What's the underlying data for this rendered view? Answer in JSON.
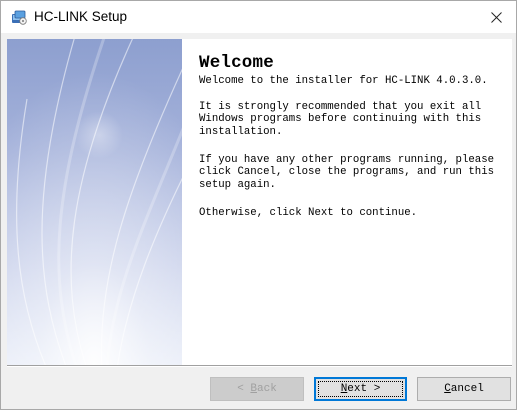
{
  "window": {
    "title": "HC-LINK Setup",
    "icon": "installer-icon",
    "close_symbol": "×"
  },
  "content": {
    "heading": "Welcome",
    "paragraph1": "Welcome to the installer for HC-LINK 4.0.3.0.",
    "paragraph2": "It is strongly recommended that you exit all\nWindows programs before continuing with this\ninstallation.",
    "paragraph3": "If you have any other programs running, please\nclick Cancel, close the programs, and run this\nsetup again.",
    "paragraph4": "Otherwise, click Next to continue."
  },
  "buttons": {
    "back": {
      "pre": "< ",
      "mnemonic": "B",
      "post": "ack",
      "enabled": false
    },
    "next": {
      "mnemonic": "N",
      "post": "ext >",
      "enabled": true,
      "focused": true
    },
    "cancel": {
      "mnemonic": "C",
      "post": "ancel",
      "enabled": true
    }
  },
  "colors": {
    "banner_top": "#8d9fcf",
    "banner_bottom": "#e6ebf7",
    "focus_border": "#0078d7",
    "disabled_text": "#a0a0a0"
  }
}
